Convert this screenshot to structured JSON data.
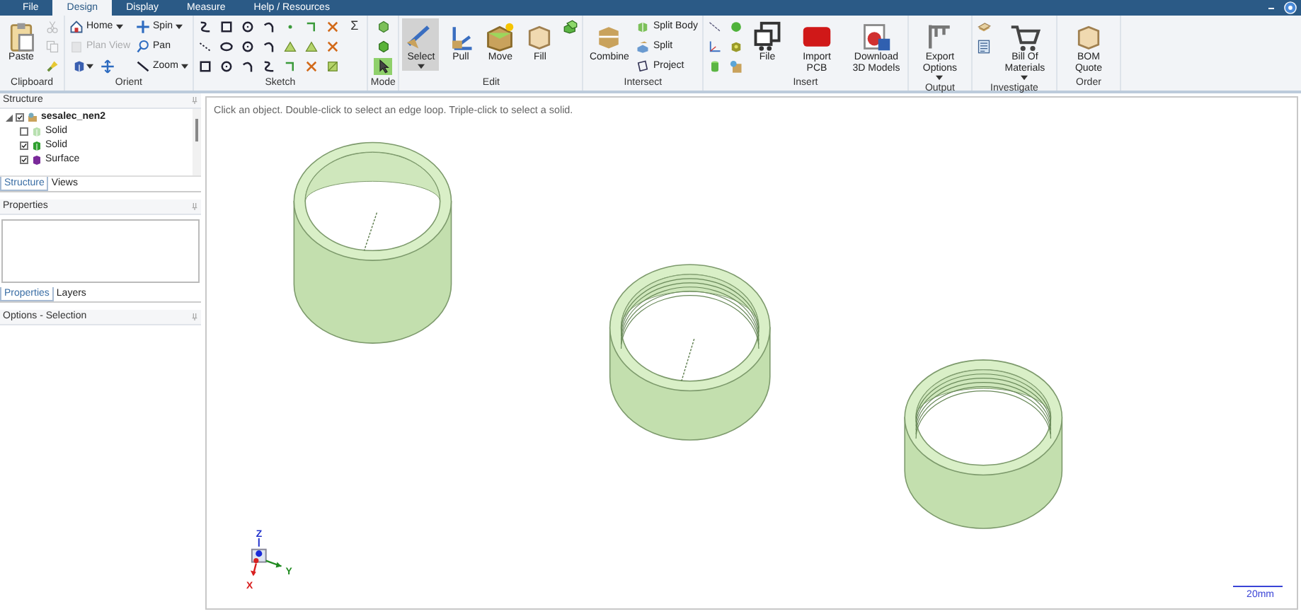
{
  "menu_tabs": [
    {
      "label": "File",
      "selected": false
    },
    {
      "label": "Design",
      "selected": true
    },
    {
      "label": "Display",
      "selected": false
    },
    {
      "label": "Measure",
      "selected": false
    },
    {
      "label": "Help / Resources",
      "selected": false
    }
  ],
  "ribbon": [
    {
      "label": "Clipboard",
      "columns": [
        [
          {
            "kind": "large",
            "label": "Paste",
            "disabled": false
          }
        ],
        [
          {
            "kind": "icon",
            "disabled": true
          },
          {
            "kind": "icon",
            "disabled": true
          },
          {
            "kind": "icon",
            "disabled": false
          }
        ]
      ]
    },
    {
      "label": "Orient",
      "columns": [
        [
          {
            "kind": "small",
            "label": "Home",
            "dropdown": true,
            "disabled": false
          },
          {
            "kind": "small",
            "label": "Plan View",
            "dropdown": false,
            "disabled": true
          },
          {
            "kind": "icons",
            "dropdown": true,
            "disabled": false
          }
        ],
        [
          {
            "kind": "small",
            "label": "Spin",
            "dropdown": true,
            "disabled": false
          },
          {
            "kind": "small",
            "label": "Pan",
            "dropdown": false,
            "disabled": false
          },
          {
            "kind": "small",
            "label": "Zoom",
            "dropdown": true,
            "disabled": false
          }
        ]
      ]
    },
    {
      "label": "Sketch",
      "columns": [
        [
          {
            "kind": "icon"
          },
          {
            "kind": "icon"
          },
          {
            "kind": "icon"
          }
        ],
        [
          {
            "kind": "icon"
          },
          {
            "kind": "icon"
          },
          {
            "kind": "icon"
          }
        ],
        [
          {
            "kind": "icon"
          },
          {
            "kind": "icon"
          },
          {
            "kind": "icon"
          }
        ],
        [
          {
            "kind": "icon"
          },
          {
            "kind": "icon"
          },
          {
            "kind": "icon"
          }
        ],
        [
          {
            "kind": "icon"
          },
          {
            "kind": "icon"
          },
          {
            "kind": "icon"
          }
        ],
        [
          {
            "kind": "icon"
          },
          {
            "kind": "icon"
          },
          {
            "kind": "icon"
          }
        ],
        [
          {
            "kind": "icon"
          },
          {
            "kind": "icon"
          },
          {
            "kind": "icon"
          }
        ],
        [
          {
            "kind": "glyph",
            "text": "Σ"
          }
        ]
      ]
    },
    {
      "label": "Mode",
      "columns": [
        [
          {
            "kind": "icon",
            "selected": false
          },
          {
            "kind": "icon",
            "selected": false
          },
          {
            "kind": "icon",
            "selected": true
          }
        ]
      ]
    },
    {
      "label": "Edit",
      "columns": [
        [
          {
            "kind": "large",
            "label": "Select",
            "dropdown": true,
            "selected": true
          }
        ],
        [
          {
            "kind": "large",
            "label": "Pull",
            "selected": false
          }
        ],
        [
          {
            "kind": "large",
            "label": "Move",
            "selected": false
          }
        ],
        [
          {
            "kind": "large",
            "label": "Fill",
            "selected": false
          }
        ],
        [
          {
            "kind": "icon",
            "selected": false
          }
        ]
      ]
    },
    {
      "label": "Intersect",
      "columns": [
        [
          {
            "kind": "large",
            "label": "Combine"
          }
        ],
        [
          {
            "kind": "small",
            "label": "Split Body"
          },
          {
            "kind": "small",
            "label": "Split"
          },
          {
            "kind": "small",
            "label": "Project"
          }
        ]
      ]
    },
    {
      "label": "Insert",
      "columns": [
        [
          {
            "kind": "icon"
          },
          {
            "kind": "icon"
          },
          {
            "kind": "icon"
          }
        ],
        [
          {
            "kind": "icon"
          },
          {
            "kind": "icon"
          },
          {
            "kind": "icon"
          }
        ],
        [
          {
            "kind": "large",
            "label": "File"
          }
        ],
        [
          {
            "kind": "large",
            "label": "Import PCB"
          }
        ],
        [
          {
            "kind": "large",
            "label": "Download 3D Models"
          }
        ]
      ]
    },
    {
      "label": "Output",
      "columns": [
        [
          {
            "kind": "large",
            "label": "Export Options",
            "dropdown": true
          }
        ]
      ]
    },
    {
      "label": "Investigate",
      "columns": [
        [
          {
            "kind": "icon"
          },
          {
            "kind": "icon"
          }
        ],
        [
          {
            "kind": "large",
            "label": "Bill Of Materials",
            "dropdown": true
          }
        ]
      ]
    },
    {
      "label": "Order",
      "columns": [
        [
          {
            "kind": "large",
            "label": "BOM Quote"
          }
        ]
      ]
    }
  ],
  "structure_panel": {
    "title": "Structure",
    "tree": [
      {
        "label": "sesalec_nen2",
        "kind": "design",
        "checked": true,
        "expanded": true,
        "children": [
          {
            "label": "Solid",
            "kind": "solid",
            "checked": false
          },
          {
            "label": "Solid",
            "kind": "solid",
            "checked": true
          },
          {
            "label": "Surface",
            "kind": "surface",
            "checked": true
          }
        ]
      }
    ],
    "tabs": [
      {
        "label": "Structure",
        "selected": true
      },
      {
        "label": "Views",
        "selected": false
      }
    ]
  },
  "properties_panel": {
    "title": "Properties",
    "tabs": [
      {
        "label": "Properties",
        "selected": true
      },
      {
        "label": "Layers",
        "selected": false
      }
    ]
  },
  "options_panel": {
    "title": "Options - Selection"
  },
  "viewport": {
    "hint": "Click an object. Double-click to select an edge loop. Triple-click to select a solid.",
    "axes": {
      "z": "Z",
      "y": "Y",
      "x": "X"
    },
    "scale_bar": "20mm"
  }
}
